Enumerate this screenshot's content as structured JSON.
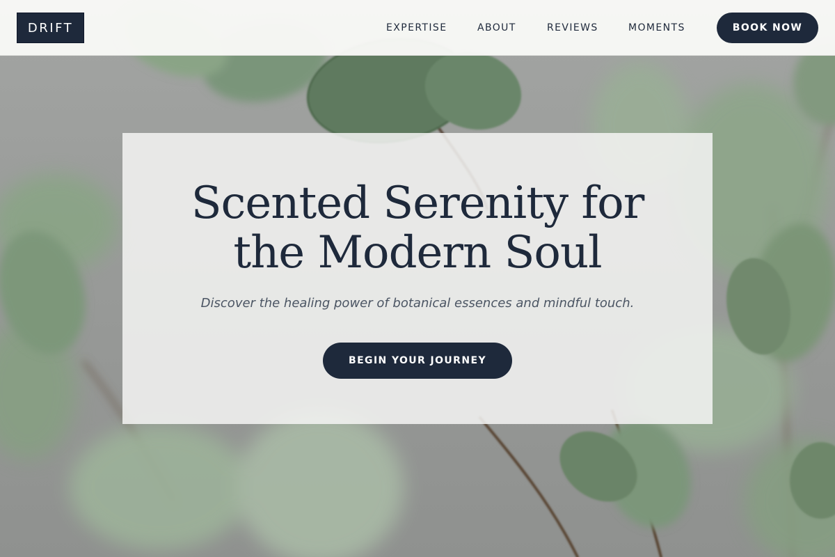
{
  "header": {
    "logo": "DRIFT",
    "nav": [
      "EXPERTISE",
      "ABOUT",
      "REVIEWS",
      "MOMENTS"
    ],
    "cta_label": "BOOK NOW"
  },
  "hero": {
    "headline_line1": "Scented Serenity for",
    "headline_line2": "the Modern Soul",
    "subheadline": "Discover the healing power of botanical essences and mindful touch.",
    "cta_label": "BEGIN YOUR JOURNEY",
    "background_image": "eucalyptus-leaves-photo"
  },
  "colors": {
    "primary": "#1e293b",
    "header_bg": "#f9f9f7",
    "card_bg": "#f4f4f3",
    "leaf": "#6f8769"
  }
}
